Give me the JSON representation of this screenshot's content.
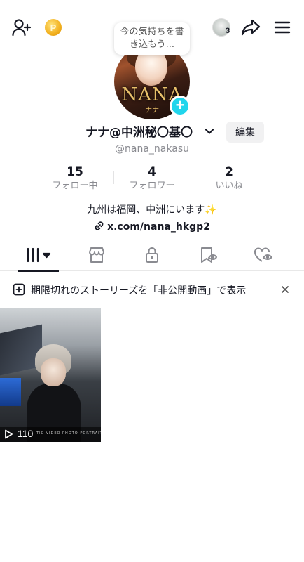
{
  "header": {
    "coin_label": "P",
    "friends_count": "3",
    "note_bubble": "今の気持ちを書き込もう..."
  },
  "profile": {
    "avatar_sign": "NANA",
    "avatar_sign_sub": "ナナ",
    "display_name": "ナナ@中洲秘〇基〇",
    "edit_label": "編集",
    "username": "@nana_nakasu",
    "bio": "九州は福岡、中洲にいます✨",
    "link": "x.com/nana_hkgp2"
  },
  "stats": [
    {
      "value": "15",
      "label": "フォロー中"
    },
    {
      "value": "4",
      "label": "フォロワー"
    },
    {
      "value": "2",
      "label": "いいね"
    }
  ],
  "tabs": [
    {
      "name": "videos",
      "icon": "videos-grid-icon",
      "active": true
    },
    {
      "name": "shop",
      "icon": "shop-icon",
      "active": false
    },
    {
      "name": "private",
      "icon": "lock-icon",
      "active": false
    },
    {
      "name": "favorites",
      "icon": "bookmark-hidden-icon",
      "active": false
    },
    {
      "name": "liked",
      "icon": "heart-hidden-icon",
      "active": false
    }
  ],
  "banner": {
    "text": "期限切れのストーリーズを「非公開動画」で表示"
  },
  "videos": [
    {
      "views": "110",
      "modes": "TIC   VIDEO   PHOTO   PORTRAIT"
    }
  ],
  "colors": {
    "accent": "#20d5ec",
    "text_primary": "#161823",
    "text_secondary": "#8a8b91"
  }
}
